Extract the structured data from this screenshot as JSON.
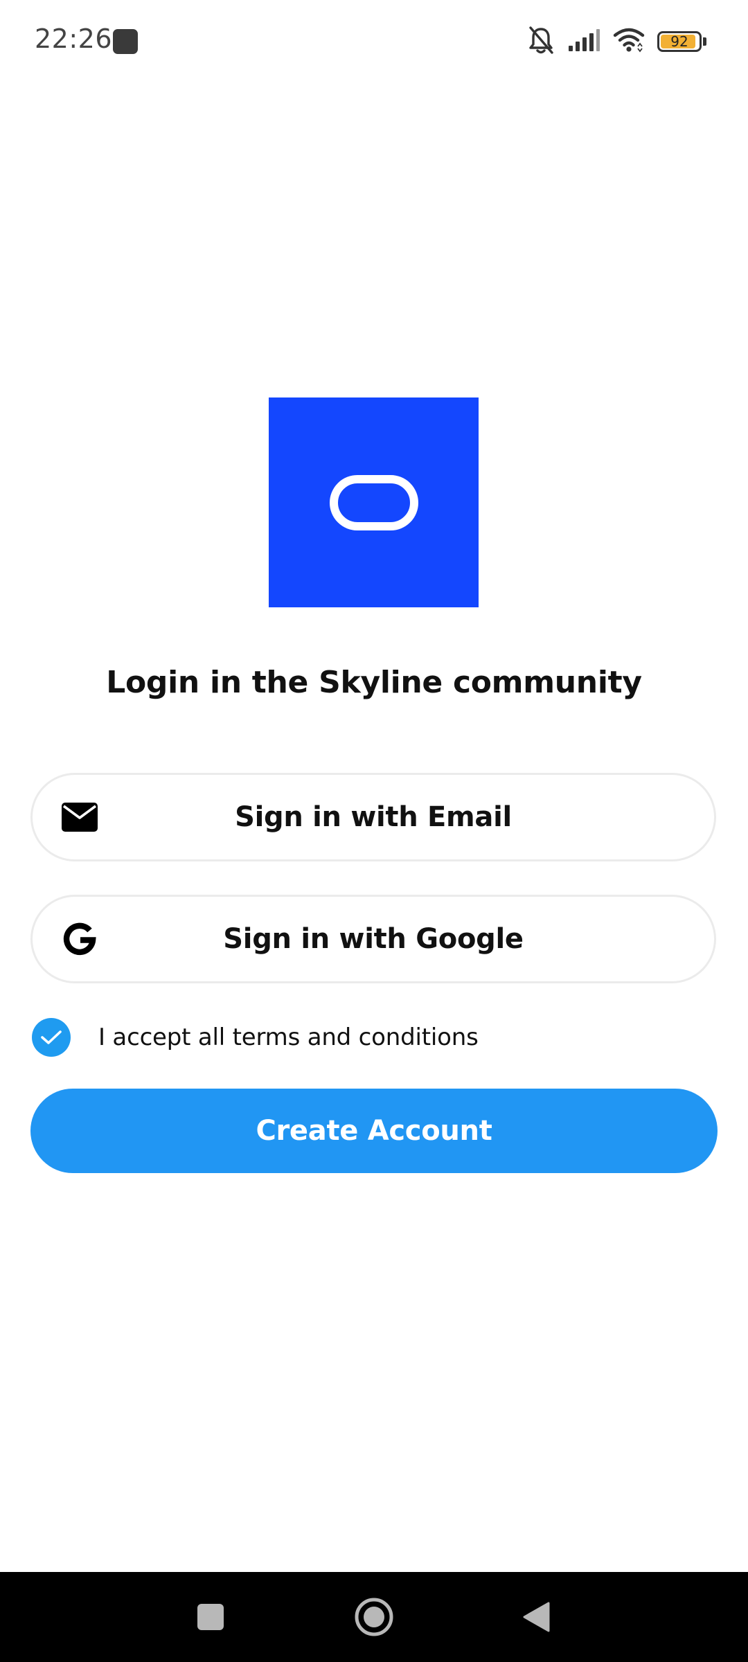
{
  "status_bar": {
    "time": "22:26",
    "battery_level": "92",
    "battery_fraction": 0.92,
    "icons": [
      "notification-app-icon",
      "bell-muted-icon",
      "signal-icon",
      "wifi-icon",
      "battery-icon"
    ]
  },
  "logo": {
    "icon": "app-logo",
    "background_color": "#1447fe"
  },
  "title": "Login in the Skyline community",
  "buttons": {
    "email": {
      "label": "Sign in with Email",
      "icon": "mail-icon"
    },
    "google": {
      "label": "Sign in with Google",
      "icon": "google-icon"
    }
  },
  "terms": {
    "label": "I accept all terms and conditions",
    "checked": true
  },
  "create_account": {
    "label": "Create Account",
    "color": "#2196f3"
  },
  "nav_bar": {
    "icons": [
      "recents-icon",
      "home-icon",
      "back-icon"
    ]
  }
}
